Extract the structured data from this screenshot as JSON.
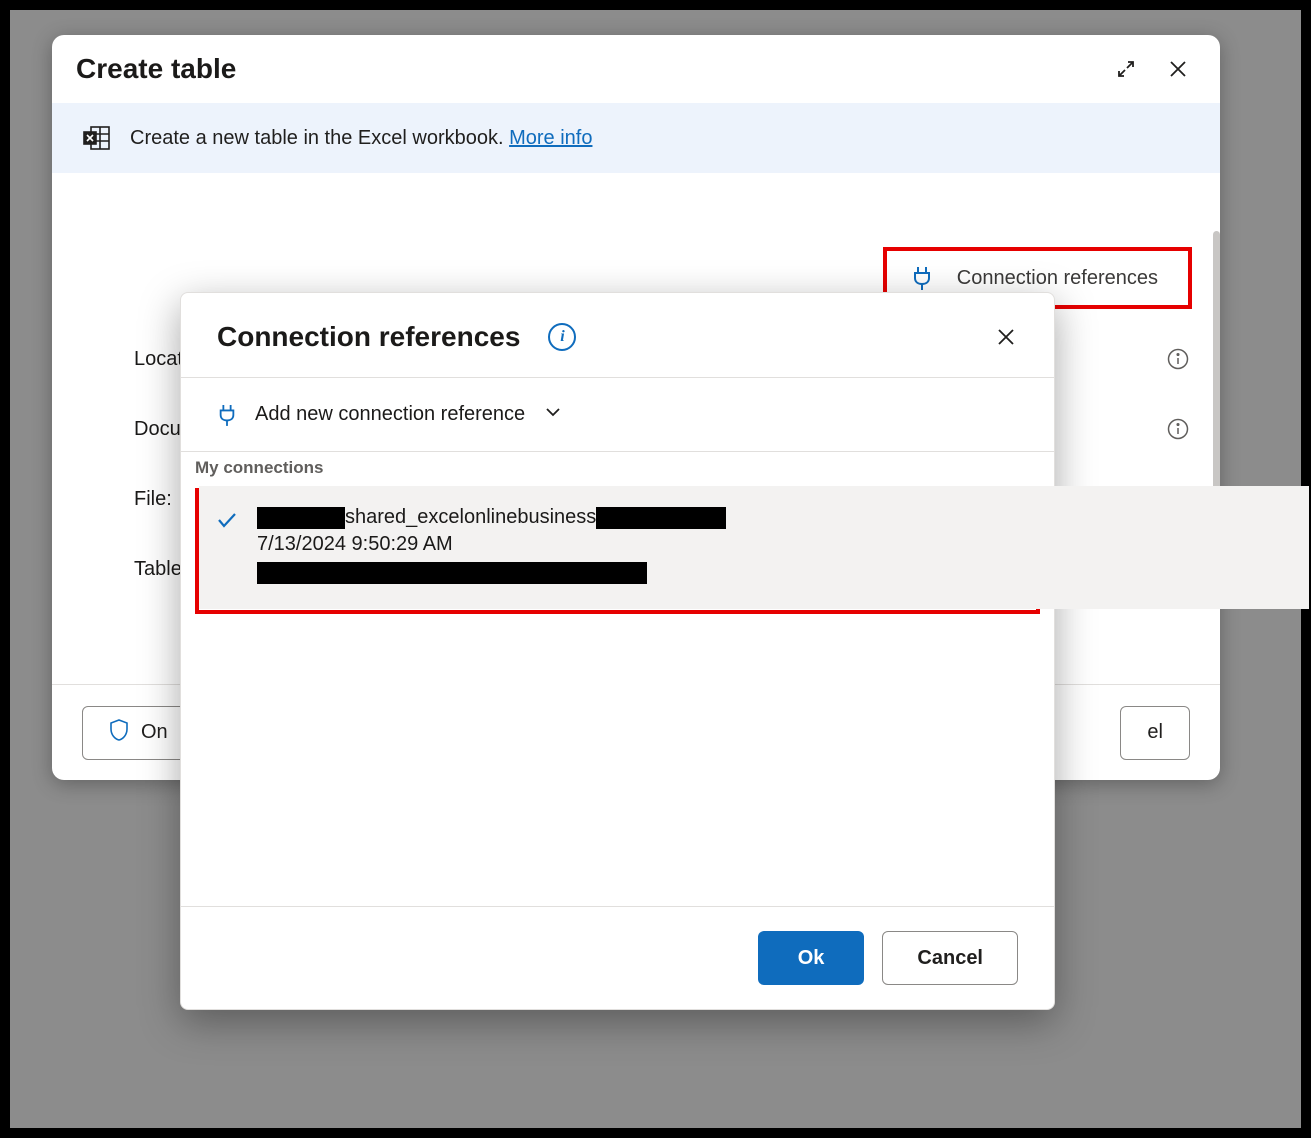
{
  "main": {
    "title": "Create table",
    "banner_text": "Create a new table in the Excel workbook. ",
    "banner_link": "More info",
    "connection_references_label": "Connection references",
    "fields": {
      "location": "Location",
      "document": "Docume",
      "file": "File:",
      "table_name": "Table na"
    },
    "footer": {
      "owner_partial": "On",
      "cancel_partial": "el"
    }
  },
  "popup": {
    "title": "Connection references",
    "add_new_label": "Add new connection reference",
    "section_header": "My connections",
    "connection": {
      "name_middle": "shared_excelonlinebusiness",
      "timestamp": "7/13/2024 9:50:29 AM"
    },
    "ok_label": "Ok",
    "cancel_label": "Cancel"
  }
}
